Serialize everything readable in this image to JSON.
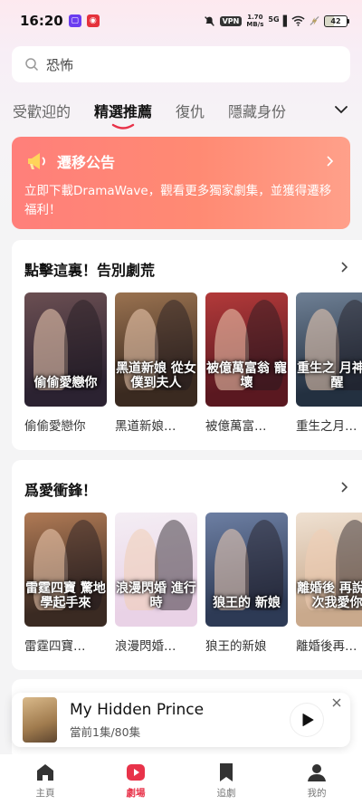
{
  "status": {
    "time": "16:20",
    "vpn": "VPN",
    "net_speed": "1.70",
    "net_unit": "MB/s",
    "signal": "5G",
    "battery": "42"
  },
  "search": {
    "query": "恐怖"
  },
  "tabs": [
    {
      "label": "受歡迎的",
      "active": false
    },
    {
      "label": "精選推薦",
      "active": true
    },
    {
      "label": "復仇",
      "active": false
    },
    {
      "label": "隱藏身份",
      "active": false
    }
  ],
  "notice": {
    "title": "遷移公告",
    "body": "立即下載DramaWave，觀看更多獨家劇集，並獲得遷移福利！"
  },
  "sections": [
    {
      "title": "點擊這裏！告別劇荒",
      "items": [
        {
          "name": "偷偷愛戀你",
          "poster_text": "偷偷愛戀你",
          "c1": "#2b2231",
          "c2": "#6b4f52"
        },
        {
          "name": "黑道新娘…",
          "poster_text": "黑道新娘 從女僕到夫人",
          "c1": "#3a2a20",
          "c2": "#9a7250"
        },
        {
          "name": "被億萬富…",
          "poster_text": "被億萬富翁 寵壞",
          "c1": "#5a1820",
          "c2": "#b33a3a"
        },
        {
          "name": "重生之月…",
          "poster_text": "重生之 月神覺醒",
          "c1": "#233040",
          "c2": "#6f8095"
        }
      ]
    },
    {
      "title": "爲愛衝鋒！",
      "items": [
        {
          "name": "雷霆四寶…",
          "poster_text": "雷霆四寶 驚地學起手來",
          "c1": "#3a2a22",
          "c2": "#b07a55"
        },
        {
          "name": "浪漫閃婚…",
          "poster_text": "浪漫閃婚 進行時",
          "c1": "#e9d2e6",
          "c2": "#f4eef4"
        },
        {
          "name": "狼王的新娘",
          "poster_text": "狼王的 新娘",
          "c1": "#2d3a55",
          "c2": "#6d7fa3"
        },
        {
          "name": "離婚後再…",
          "poster_text": "離婚後 再說一次我愛你",
          "c1": "#c9a98c",
          "c2": "#efe1d2"
        }
      ]
    }
  ],
  "mini_player": {
    "title": "My Hidden Prince",
    "episode": "當前1集/80集"
  },
  "nav": [
    {
      "label": "主頁",
      "icon": "home-icon",
      "active": false
    },
    {
      "label": "劇場",
      "icon": "theater-icon",
      "active": true
    },
    {
      "label": "追劇",
      "icon": "bookmark-icon",
      "active": false
    },
    {
      "label": "我的",
      "icon": "profile-icon",
      "active": false
    }
  ],
  "colors": {
    "accent": "#e8334a",
    "notice_start": "#ff7f7a",
    "notice_end": "#ffa08a"
  }
}
